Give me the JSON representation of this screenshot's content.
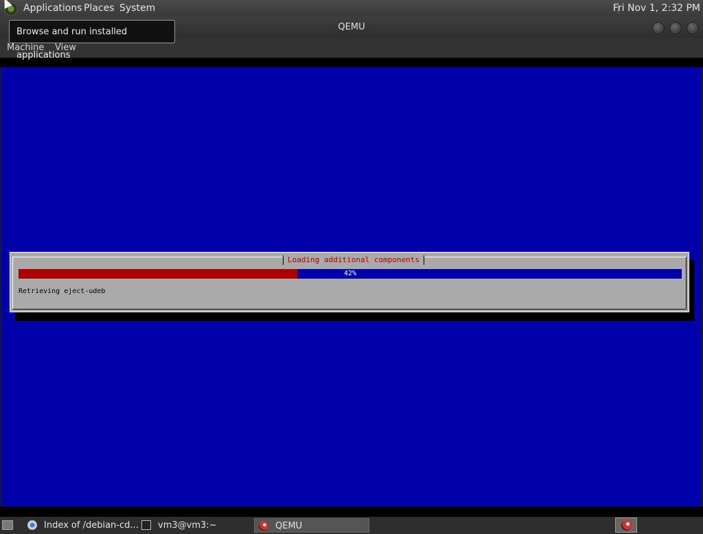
{
  "top_panel": {
    "menu": [
      "Applications",
      "Places",
      "System"
    ],
    "clock": "Fri Nov 1,  2:32 PM"
  },
  "tooltip": "Browse and run installed applications",
  "window": {
    "title": "QEMU",
    "menu": [
      "Machine",
      "View"
    ]
  },
  "installer": {
    "dialog_title": "Loading additional components",
    "progress": 0.42,
    "progress_label": "42%",
    "status": "Retrieving eject-udeb"
  },
  "taskbar": {
    "tasks": [
      {
        "label": "Index of /debian-cd...",
        "icon": "chrome-icon"
      },
      {
        "label": "vm3@vm3:~",
        "icon": "terminal-icon"
      },
      {
        "label": "QEMU",
        "icon": "qemu-icon"
      }
    ]
  },
  "colors": {
    "screen_bg": "#0000aa",
    "dialog_bg": "#aaaaaa",
    "progress_fill": "#aa0000",
    "title_text": "#aa0000"
  }
}
